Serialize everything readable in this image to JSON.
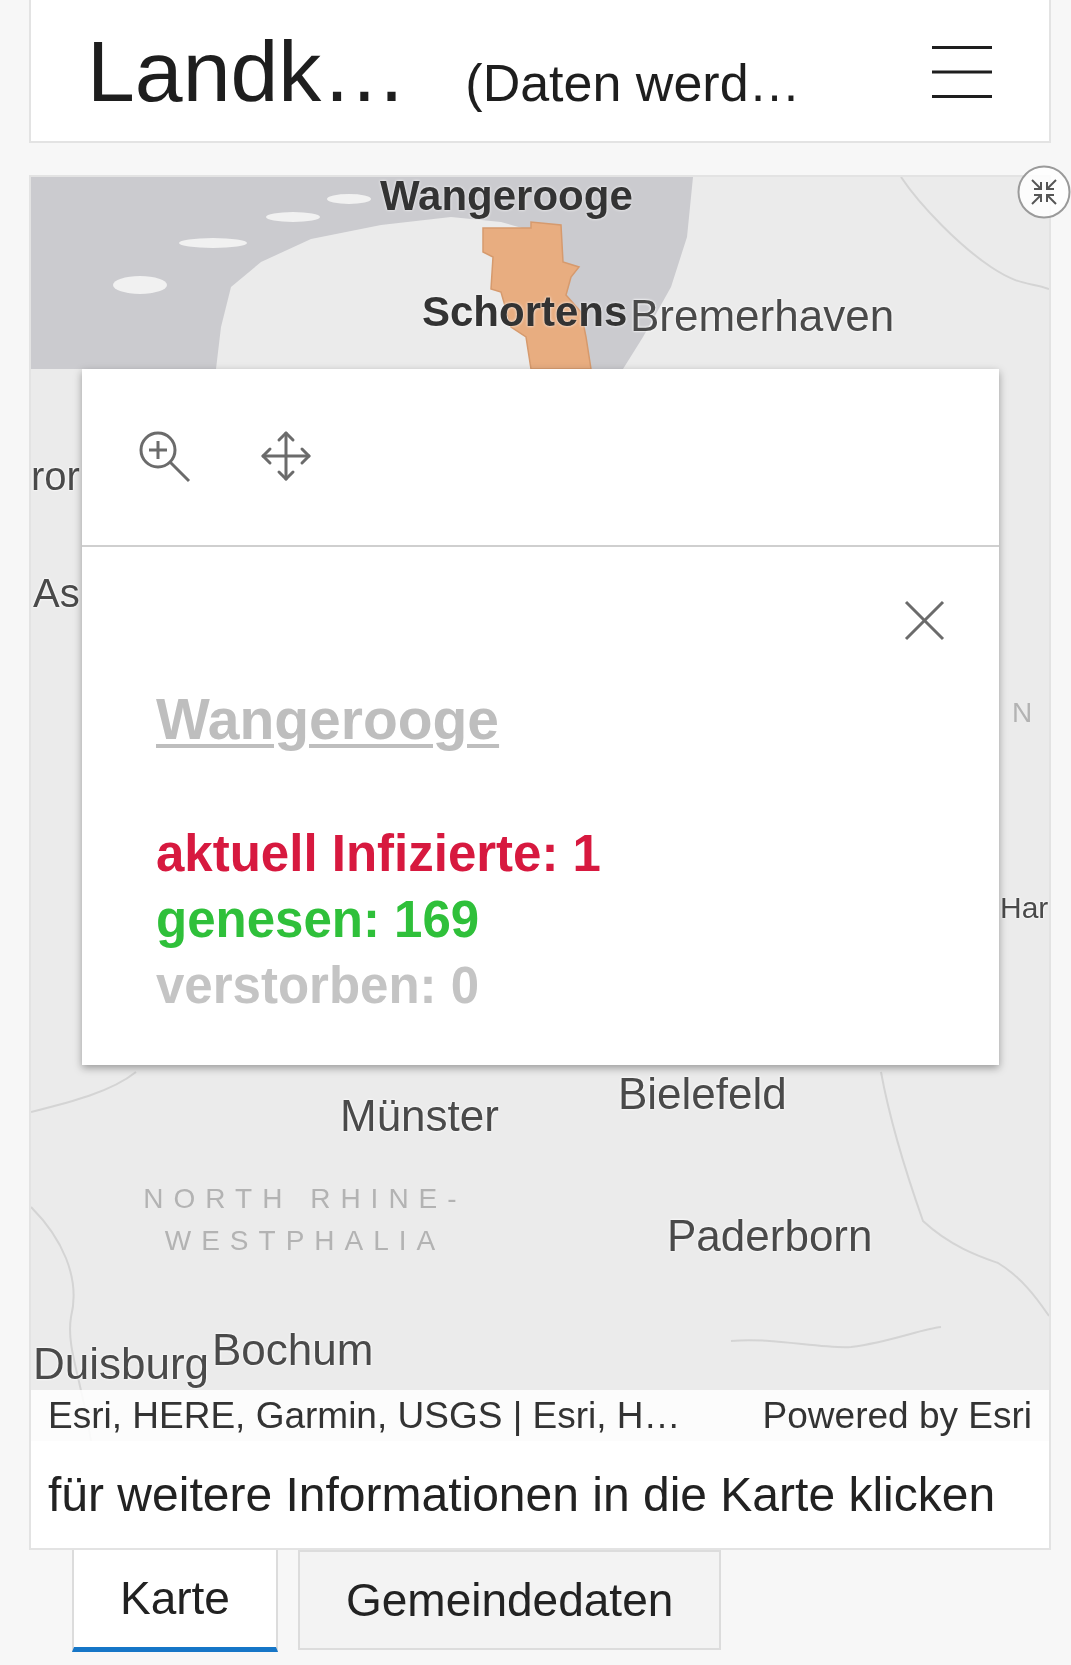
{
  "header": {
    "title": "Landk…",
    "subtitle": "(Daten werd…"
  },
  "map": {
    "labels": [
      {
        "text": "Wangerooge",
        "kind": "feature"
      },
      {
        "text": "Schortens",
        "kind": "feature"
      },
      {
        "text": "Bremerhaven",
        "kind": "city"
      },
      {
        "text": "ror",
        "kind": "city"
      },
      {
        "text": "As",
        "kind": "city"
      },
      {
        "text": "N",
        "kind": "region"
      },
      {
        "text": "Har",
        "kind": "city"
      },
      {
        "text": "Bielefeld",
        "kind": "city"
      },
      {
        "text": "Münster",
        "kind": "city"
      },
      {
        "text": "NORTH RHINE-WESTPHALIA",
        "kind": "region"
      },
      {
        "text": "Paderborn",
        "kind": "city"
      },
      {
        "text": "Bochum",
        "kind": "city"
      },
      {
        "text": "Duisburg",
        "kind": "city"
      }
    ],
    "popup": {
      "title": "Wangerooge",
      "stats": [
        {
          "text": "aktuell Infizierte: 1",
          "color": "#d7193f"
        },
        {
          "text": "genesen: 169",
          "color": "#2fc03a"
        },
        {
          "text": "verstorben: 0",
          "color": "#c4c4c4"
        }
      ]
    },
    "attribution": "Esri, HERE, Garmin, USGS | Esri, H…",
    "powered_by": "Powered by Esri"
  },
  "caption": "für weitere Informationen in die Karte klicken",
  "tabs": [
    {
      "label": "Karte",
      "selected": true
    },
    {
      "label": "Gemeindedaten",
      "selected": false
    }
  ]
}
